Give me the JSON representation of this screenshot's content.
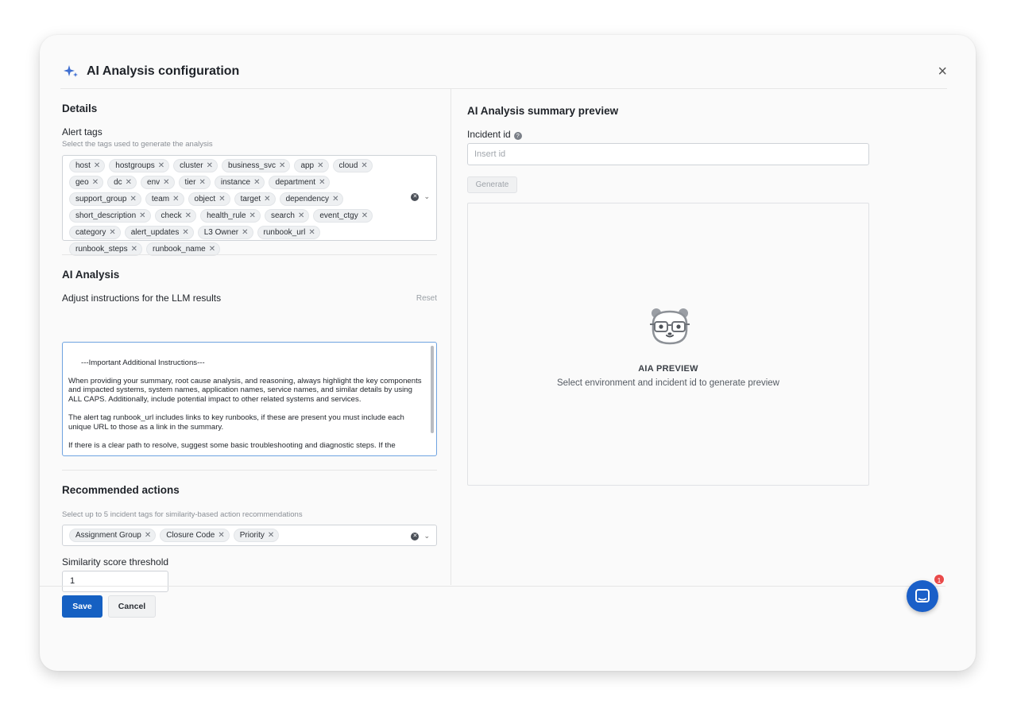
{
  "dialog": {
    "title": "AI Analysis configuration",
    "close_label": "×"
  },
  "details": {
    "heading": "Details",
    "alert_tags_label": "Alert tags",
    "alert_tags_help": "Select the tags used to generate the analysis",
    "tags": [
      "host",
      "hostgroups",
      "cluster",
      "business_svc",
      "app",
      "cloud",
      "geo",
      "dc",
      "env",
      "tier",
      "instance",
      "department",
      "support_group",
      "team",
      "object",
      "target",
      "dependency",
      "short_description",
      "check",
      "health_rule",
      "search",
      "event_ctgy",
      "category",
      "alert_updates",
      "L3 Owner",
      "runbook_url",
      "runbook_steps",
      "runbook_name"
    ]
  },
  "ai_analysis": {
    "heading": "AI Analysis",
    "instructions_label": "Adjust instructions for the LLM results",
    "reset_label": "Reset",
    "instructions_text": "---Important Additional Instructions---\n\nWhen providing your summary, root cause analysis, and reasoning, always highlight the key components and impacted systems, system names, application names, service names, and similar details by using ALL CAPS. Additionally, include potential impact to other related systems and services.\n\nThe alert tag runbook_url includes links to key runbooks, if these are present you must include each unique URL to those as a link in the summary.\n\nIf there is a clear path to resolve, suggest some basic troubleshooting and diagnostic steps. If the"
  },
  "recommended": {
    "heading": "Recommended actions",
    "help": "Select up to 5 incident tags for similarity-based action recommendations",
    "tags": [
      "Assignment Group",
      "Closure Code",
      "Priority"
    ],
    "threshold_label": "Similarity score threshold",
    "threshold_value": "1"
  },
  "preview": {
    "heading": "AI Analysis summary preview",
    "incident_label": "Incident id",
    "incident_placeholder": "Insert id",
    "generate_label": "Generate",
    "empty_title": "AIA PREVIEW",
    "empty_text": "Select environment and incident id to generate preview"
  },
  "footer": {
    "save_label": "Save",
    "cancel_label": "Cancel"
  },
  "chat": {
    "badge_count": "1"
  },
  "colors": {
    "primary": "#1560c2",
    "focus_border": "#6fa3e0",
    "badge": "#e94a4a"
  }
}
